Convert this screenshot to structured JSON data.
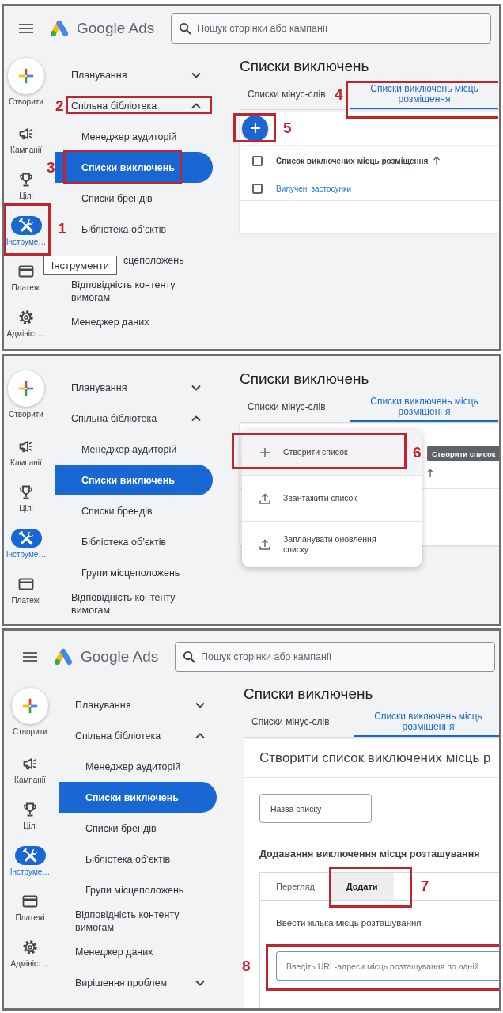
{
  "panels": [
    {
      "kind": "list",
      "top_bar": {
        "product": "Google Ads",
        "search": {
          "placeholder": "Пошук сторінки або кампанії"
        }
      },
      "rail": {
        "create": {
          "label": "Створити"
        },
        "items": [
          {
            "label": "Кампанії",
            "selected": false
          },
          {
            "label": "Цілі",
            "selected": false
          },
          {
            "label": "Інструме…",
            "selected": true,
            "callout": "1",
            "tooltip": "Інструменти"
          },
          {
            "label": "Платежі",
            "selected": false
          },
          {
            "label": "Адмініст…",
            "selected": false
          }
        ]
      },
      "nav": [
        {
          "kind": "group",
          "label": "Планування",
          "expanded": false
        },
        {
          "kind": "group",
          "label": "Спільна бібліотека",
          "expanded": true,
          "callout": "2",
          "children": [
            {
              "label": "Менеджер аудиторій",
              "selected": false
            },
            {
              "label": "Списки виключень",
              "selected": true,
              "callout": "3"
            },
            {
              "label": "Списки брендів",
              "selected": false
            },
            {
              "label": "Бібліотека об’єктів",
              "selected": false
            },
            {
              "label": "сцеположень",
              "selected": false,
              "covered": true
            }
          ]
        },
        {
          "kind": "link",
          "label": "Відповідність контенту вимогам"
        },
        {
          "kind": "link",
          "label": "Менеджер даних"
        }
      ],
      "main": {
        "title": "Списки виключень",
        "tabs": [
          {
            "label": "Списки мінус-слів",
            "selected": false
          },
          {
            "label": "Списки виключень місць розміщення",
            "selected": true,
            "callout": "4"
          }
        ],
        "table": {
          "add_button": {
            "callout": "5"
          },
          "select_all": {
            "checked": false
          },
          "columns": [
            {
              "label": "Список виключених місць розміщення",
              "sorted": true
            }
          ],
          "rows": [
            {
              "checked": false,
              "name": "Вилучені застосунки"
            }
          ]
        }
      }
    },
    {
      "kind": "menu",
      "rail": {
        "create": {
          "label": "Створити"
        },
        "items": [
          {
            "label": "Кампанії",
            "selected": false
          },
          {
            "label": "Цілі",
            "selected": false
          },
          {
            "label": "Інструме…",
            "selected": true
          },
          {
            "label": "Платежі",
            "selected": false
          }
        ]
      },
      "nav": [
        {
          "kind": "group",
          "label": "Планування",
          "expanded": false
        },
        {
          "kind": "group",
          "label": "Спільна бібліотека",
          "expanded": true,
          "children": [
            {
              "label": "Менеджер аудиторій",
              "selected": false
            },
            {
              "label": "Списки виключень",
              "selected": true
            },
            {
              "label": "Списки брендів",
              "selected": false
            },
            {
              "label": "Бібліотека об’єктів",
              "selected": false
            },
            {
              "label": "Групи місцеположень",
              "selected": false
            }
          ]
        },
        {
          "kind": "link",
          "label": "Відповідність контенту вимогам"
        }
      ],
      "main": {
        "title": "Списки виключень",
        "tabs": [
          {
            "label": "Списки мінус-слів",
            "selected": false
          },
          {
            "label": "Списки виключень місць розміщення",
            "selected": true
          }
        ],
        "table": {
          "columns": [
            {
              "sorted": true
            }
          ]
        },
        "menu": {
          "items": [
            {
              "kind": "create",
              "label": "Створити список",
              "hovered": true,
              "callout": "6",
              "tooltip": "Створити список"
            },
            {
              "kind": "upload",
              "label": "Звантажити список",
              "hovered": false
            },
            {
              "kind": "schedule",
              "label": "Запланувати оновлення списку",
              "hovered": false
            }
          ]
        }
      }
    },
    {
      "kind": "form",
      "top_bar": {
        "product": "Google Ads",
        "search": {
          "placeholder": "Пошук сторінки або кампанії"
        }
      },
      "rail": {
        "create": {
          "label": "Створити"
        },
        "items": [
          {
            "label": "Кампанії",
            "selected": false
          },
          {
            "label": "Цілі",
            "selected": false
          },
          {
            "label": "Інструме…",
            "selected": true
          },
          {
            "label": "Платежі",
            "selected": false
          },
          {
            "label": "Адмініст…",
            "selected": false
          }
        ]
      },
      "nav": [
        {
          "kind": "group",
          "label": "Планування",
          "expanded": false
        },
        {
          "kind": "group",
          "label": "Спільна бібліотека",
          "expanded": true,
          "children": [
            {
              "label": "Менеджер аудиторій",
              "selected": false
            },
            {
              "label": "Списки виключень",
              "selected": true
            },
            {
              "label": "Списки брендів",
              "selected": false
            },
            {
              "label": "Бібліотека об’єктів",
              "selected": false
            },
            {
              "label": "Групи місцеположень",
              "selected": false
            }
          ]
        },
        {
          "kind": "link",
          "label": "Відповідність контенту вимогам"
        },
        {
          "kind": "link",
          "label": "Менеджер даних"
        },
        {
          "kind": "group",
          "label": "Вирішення проблем",
          "expanded": false
        }
      ],
      "main": {
        "title": "Списки виключень",
        "tabs": [
          {
            "label": "Списки мінус-слів",
            "selected": false
          },
          {
            "label": "Списки виключень місць розміщення",
            "selected": true
          }
        ],
        "form": {
          "heading": "Створити список виключених місць р",
          "name_field": {
            "placeholder": "Назва списку"
          },
          "section_title": "Додавання виключення місця розташування",
          "tabs": [
            {
              "label": "Перегляд",
              "selected": false
            },
            {
              "label": "Додати",
              "selected": true,
              "callout": "7"
            }
          ],
          "input_label": "Ввести кілька місць розташування",
          "urls_field": {
            "placeholder": "Введіть URL-адреси місць розташування по одній",
            "callout": "8"
          }
        }
      }
    }
  ]
}
